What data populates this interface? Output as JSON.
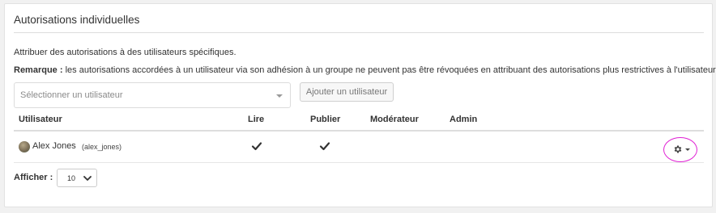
{
  "panel": {
    "title": "Autorisations individuelles",
    "intro": "Attribuer des autorisations à des utilisateurs spécifiques.",
    "note_label": "Remarque :",
    "note_text": " les autorisations accordées à un utilisateur via son adhésion à un groupe ne peuvent pas être révoquées en attribuant des autorisations plus restrictives à l'utilisateur."
  },
  "user_select": {
    "placeholder": "Sélectionner un utilisateur",
    "caret_icon": "caret-down-icon"
  },
  "add_button": {
    "label": "Ajouter un utilisateur"
  },
  "table": {
    "columns": [
      "Utilisateur",
      "Lire",
      "Publier",
      "Modérateur",
      "Admin"
    ],
    "rows": [
      {
        "name": "Alex Jones",
        "login": "(alex_jones)",
        "avatar_icon": "user-avatar",
        "lire": true,
        "publier": true,
        "moderateur": false,
        "admin": false,
        "actions_icon": "gear-icon"
      }
    ]
  },
  "pagination": {
    "label": "Afficher :",
    "page_size": "10"
  },
  "colors": {
    "highlight": "#e020d4",
    "border": "#dddddd",
    "text": "#333333",
    "background": "#f1f1f1"
  }
}
